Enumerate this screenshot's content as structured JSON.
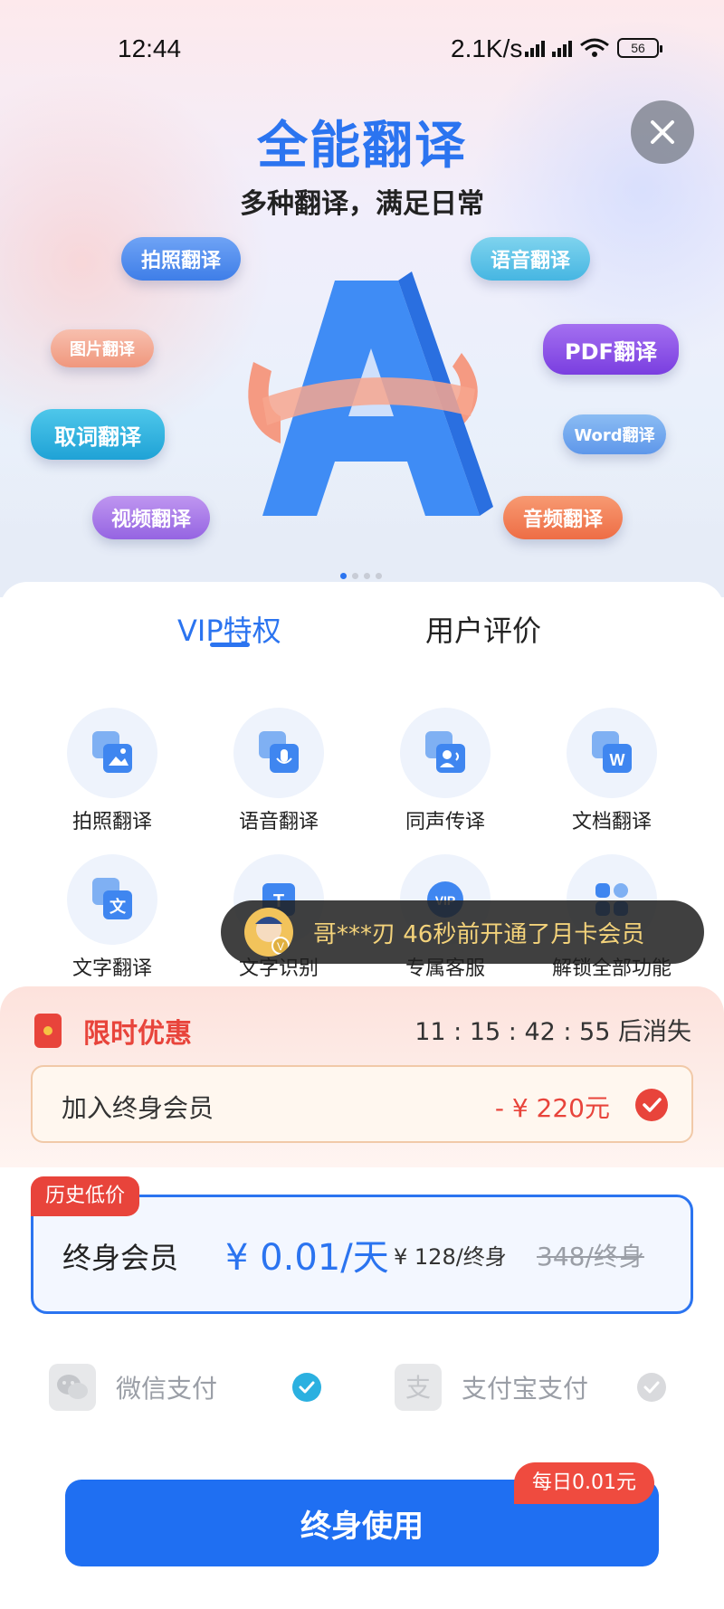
{
  "status_bar": {
    "time": "12:44",
    "speed": "2.1K/s",
    "battery": "56"
  },
  "hero": {
    "title": "全能翻译",
    "subtitle": "多种翻译，满足日常",
    "pills": [
      {
        "label": "拍照翻译",
        "color": "#4a87ef"
      },
      {
        "label": "语音翻译",
        "color": "#5cc4e6"
      },
      {
        "label": "图片翻译",
        "color": "#f2a58f"
      },
      {
        "label": "PDF翻译",
        "color": "#8a4fe6"
      },
      {
        "label": "取词翻译",
        "color": "#2bb0e0"
      },
      {
        "label": "Word翻译",
        "color": "#6ea6ee"
      },
      {
        "label": "视频翻译",
        "color": "#a77be8"
      },
      {
        "label": "音频翻译",
        "color": "#f07a52"
      }
    ]
  },
  "tabs": {
    "vip": "VIP特权",
    "reviews": "用户评价"
  },
  "features": [
    {
      "label": "拍照翻译",
      "icon": "photo-translate-icon"
    },
    {
      "label": "语音翻译",
      "icon": "voice-translate-icon"
    },
    {
      "label": "同声传译",
      "icon": "simultaneous-interpret-icon"
    },
    {
      "label": "文档翻译",
      "icon": "document-translate-icon"
    },
    {
      "label": "文字翻译",
      "icon": "text-translate-icon"
    },
    {
      "label": "文字识别",
      "icon": "text-recognition-icon"
    },
    {
      "label": "专属客服",
      "icon": "vip-service-icon"
    },
    {
      "label": "解锁全部功能",
      "icon": "unlock-all-icon"
    }
  ],
  "toast": {
    "text": "哥***刃 46秒前开通了月卡会员"
  },
  "promo": {
    "title": "限时优惠",
    "countdown": "11 : 15 : 42 : 55  后消失",
    "lifetime_label": "加入终身会员",
    "lifetime_discount": "- ¥ 220元"
  },
  "plan": {
    "badge": "历史低价",
    "name": "终身会员",
    "price_per_day": "¥ 0.01/天",
    "total": "¥ 128/终身",
    "original": "348/终身"
  },
  "payment": {
    "wechat": "微信支付",
    "alipay": "支付宝支付"
  },
  "cta": {
    "label": "终身使用",
    "tag": "每日0.01元"
  },
  "colors": {
    "accent": "#2b74f0",
    "promo_red": "#e8443b",
    "wechat_check": "#2bb0e0"
  }
}
